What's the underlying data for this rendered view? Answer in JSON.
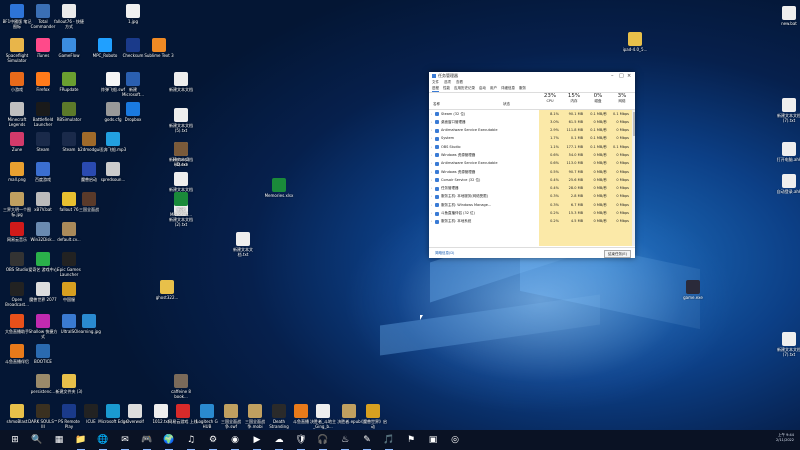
{
  "desktop": {
    "icons": [
      {
        "label": "BF1中國版 笔记图标",
        "color": "#2d74d9"
      },
      {
        "label": "Total Commander",
        "color": "#3a6fb5"
      },
      {
        "label": "fallout76 - 快捷方式",
        "color": "#eaeaea"
      },
      {
        "label": "1.jpg",
        "color": "#f0f0f0"
      },
      {
        "label": "Spaceflight Simulator",
        "color": "#e8b54a"
      },
      {
        "label": "iTunes",
        "color": "#ff4a8a"
      },
      {
        "label": "GameFlow",
        "color": "#3b8de0"
      },
      {
        "label": "MPC_Roboto",
        "color": "#20a0ff"
      },
      {
        "label": "Checksum",
        "color": "#1a3a8a"
      },
      {
        "label": "Sublime Text 3",
        "color": "#f08a24"
      },
      {
        "label": "新建文本文档",
        "color": "#eeeeee"
      },
      {
        "label": "小游戏",
        "color": "#e86a1a"
      },
      {
        "label": "Firefox",
        "color": "#ff7a1a"
      },
      {
        "label": "FRupdate",
        "color": "#6aa030"
      },
      {
        "label": "炸弹飞船.swf",
        "color": "#f5f5f5"
      },
      {
        "label": "新建 Microsoft...",
        "color": "#2a5fb0"
      },
      {
        "label": "新建文本文档 (5).txt",
        "color": "#eeeeee"
      },
      {
        "label": "Minecraft Legends",
        "color": "#c0c0c0"
      },
      {
        "label": "Battlefield Launcher",
        "color": "#1a1a1a"
      },
      {
        "label": "RBSimulator",
        "color": "#5c7a2a"
      },
      {
        "label": "gods.cfg",
        "color": "#999999"
      },
      {
        "label": "Dropbox",
        "color": "#1a7ae0"
      },
      {
        "label": "新建文本文档 (4).txt",
        "color": "#eeeeee"
      },
      {
        "label": "Zune",
        "color": "#d23a6a"
      },
      {
        "label": "Steam",
        "color": "#1a2a4a"
      },
      {
        "label": "Steam",
        "color": "#1a2a4a"
      },
      {
        "label": "b2dmodgui",
        "color": "#a06a2a"
      },
      {
        "label": "丢弃飞船.mp3",
        "color": "#22a0e0"
      },
      {
        "label": "新建文本文档 (3).txt",
        "color": "#eeeeee"
      },
      {
        "label": "新建文本文档 (2).txt",
        "color": "#eeeeee"
      },
      {
        "label": "mall.png",
        "color": "#e8a030"
      },
      {
        "label": "百度游戏",
        "color": "#3b6fd0"
      },
      {
        "label": "魔兽启动",
        "color": "#2a4ab0"
      },
      {
        "label": "spredsoun...",
        "color": "#cccccc"
      },
      {
        "label": "Heroes3 HD.exe",
        "color": "#7a5a3a"
      },
      {
        "label": "三界大明一个图标.jpg",
        "color": "#c0a060"
      },
      {
        "label": "xB7V.bat",
        "color": "#bbbbbb"
      },
      {
        "label": "fallout 76",
        "color": "#e8c030"
      },
      {
        "label": "三国全面战",
        "color": "#5a3a2a"
      },
      {
        "label": "新建 Microsoft...",
        "color": "#1a8a3a"
      },
      {
        "label": "网易云音乐",
        "color": "#d01a1a"
      },
      {
        "label": "Win32Disk...",
        "color": "#6a8ab0"
      },
      {
        "label": "default.cv...",
        "color": "#aa8a5a"
      },
      {
        "label": "OBS Studio",
        "color": "#333333"
      },
      {
        "label": "爱奇艺 游戏中心",
        "color": "#2ab04a"
      },
      {
        "label": "Epic Games Launcher",
        "color": "#222222"
      },
      {
        "label": "Open Broadcast...",
        "color": "#222222"
      },
      {
        "label": "魔兽世界 2077",
        "color": "#dddddd"
      },
      {
        "label": "中国服",
        "color": "#d8a020"
      },
      {
        "label": "ghost322...",
        "color": "#e8c04a"
      },
      {
        "label": "大鱼直播助手",
        "color": "#e8501a"
      },
      {
        "label": "Shallow 快捷方式",
        "color": "#c02ab0"
      },
      {
        "label": "UltraISO",
        "color": "#3a7ad0"
      },
      {
        "label": "learning.jpg",
        "color": "#2a8ad0"
      },
      {
        "label": "斗鱼直播伴侣",
        "color": "#e87a1a"
      },
      {
        "label": "BOOTICE",
        "color": "#2a6ab0"
      },
      {
        "label": "persistenc...",
        "color": "#9a8a6a"
      },
      {
        "label": "新建文件夹 (3)",
        "color": "#e8c04a"
      },
      {
        "label": "caffeine 8 book...",
        "color": "#7a6a5a"
      },
      {
        "label": "shmoBlast",
        "color": "#e8c04a"
      },
      {
        "label": "DARK SOULS™ III",
        "color": "#3a3020"
      },
      {
        "label": "PS Remote Play",
        "color": "#1a3a8a"
      },
      {
        "label": "ICUE",
        "color": "#222222"
      },
      {
        "label": "Microsoft Edge",
        "color": "#1a9ad0"
      },
      {
        "label": "Overwolf",
        "color": "#dddddd"
      },
      {
        "label": "1012.txt",
        "color": "#eeeeee"
      },
      {
        "label": "网易云游戏 上线",
        "color": "#d82a2a"
      },
      {
        "label": "Logitech G HUB",
        "color": "#2a8ad0"
      },
      {
        "label": "三国全面战争.swf",
        "color": "#c0a060"
      },
      {
        "label": "三国全面战争.mobi",
        "color": "#c0a060"
      },
      {
        "label": "Death Stranding",
        "color": "#2a2a2a"
      },
      {
        "label": "斗鱼直播",
        "color": "#e87a1a"
      },
      {
        "label": "决胜者_斗地主_Ging_b...",
        "color": "#eeeeee"
      },
      {
        "label": "决胜者.epub",
        "color": "#c0a060"
      },
      {
        "label": "《魔兽世界》启动",
        "color": "#d8a020"
      },
      {
        "label": "ipad-4.0_5...",
        "color": "#e8c04a"
      },
      {
        "label": "new.bat",
        "color": "#eeeeee"
      },
      {
        "label": "新建文本文档 (7).txt",
        "color": "#eeeeee"
      },
      {
        "label": "打开电脑.ahk",
        "color": "#eeeeee"
      },
      {
        "label": "自动登录.ahk",
        "color": "#eeeeee"
      },
      {
        "label": "Memories.xlsx",
        "color": "#1a8a3a"
      },
      {
        "label": "新建文本文档.txt",
        "color": "#eeeeee"
      },
      {
        "label": "新建文本文档 (7).txt",
        "color": "#eeeeee"
      },
      {
        "label": "game.exe",
        "color": "#2a2a3a"
      }
    ]
  },
  "taskmanager": {
    "title": "任务管理器",
    "menu": [
      "文件",
      "选项",
      "查看"
    ],
    "tabs": [
      "进程",
      "性能",
      "应用历史记录",
      "启动",
      "用户",
      "详细信息",
      "服务"
    ],
    "header_name": "名称",
    "header_status": "状态",
    "columns": [
      {
        "pct": "23%",
        "label": "CPU"
      },
      {
        "pct": "15%",
        "label": "内存"
      },
      {
        "pct": "0%",
        "label": "磁盘"
      },
      {
        "pct": "3%",
        "label": "网络"
      }
    ],
    "rows": [
      {
        "name": "Steam (32 位)",
        "cpu": "8.1%",
        "mem": "90.1 MB",
        "disk": "0.1 MB/秒",
        "net": "0.1 Mbps"
      },
      {
        "name": "桌面窗口管理器",
        "cpu": "3.0%",
        "mem": "61.5 MB",
        "disk": "0 MB/秒",
        "net": "0 Mbps"
      },
      {
        "name": "Antimalware Service Executable",
        "cpu": "2.9%",
        "mem": "111.8 MB",
        "disk": "0.1 MB/秒",
        "net": "0 Mbps"
      },
      {
        "name": "System",
        "cpu": "1.7%",
        "mem": "0.1 MB",
        "disk": "0.1 MB/秒",
        "net": "0 Mbps"
      },
      {
        "name": "OBS Studio",
        "cpu": "1.1%",
        "mem": "177.1 MB",
        "disk": "0.1 MB/秒",
        "net": "0.1 Mbps"
      },
      {
        "name": "Windows 资源管理器",
        "cpu": "0.6%",
        "mem": "54.0 MB",
        "disk": "0 MB/秒",
        "net": "0 Mbps"
      },
      {
        "name": "Antimalware Service Executable",
        "cpu": "0.6%",
        "mem": "113.0 MB",
        "disk": "0 MB/秒",
        "net": "0 Mbps"
      },
      {
        "name": "Windows 资源管理器",
        "cpu": "0.5%",
        "mem": "90.7 MB",
        "disk": "0 MB/秒",
        "net": "0 Mbps"
      },
      {
        "name": "Corsair Service (32 位)",
        "cpu": "0.4%",
        "mem": "25.6 MB",
        "disk": "0 MB/秒",
        "net": "0 Mbps"
      },
      {
        "name": "任务管理器",
        "cpu": "0.4%",
        "mem": "28.0 MB",
        "disk": "0 MB/秒",
        "net": "0 Mbps"
      },
      {
        "name": "服务主机: 本地服务(网络受限)",
        "cpu": "0.3%",
        "mem": "2.8 MB",
        "disk": "0 MB/秒",
        "net": "0 Mbps"
      },
      {
        "name": "服务主机: Windows Manage...",
        "cpu": "0.3%",
        "mem": "6.7 MB",
        "disk": "0 MB/秒",
        "net": "0 Mbps"
      },
      {
        "name": "斗鱼直播伴侣 (32 位)",
        "cpu": "0.2%",
        "mem": "15.3 MB",
        "disk": "0 MB/秒",
        "net": "0 Mbps"
      },
      {
        "name": "服务主机: 本地系统",
        "cpu": "0.2%",
        "mem": "4.5 MB",
        "disk": "0 MB/秒",
        "net": "0 Mbps"
      }
    ],
    "fewer_details": "简略信息(D)",
    "end_task": "结束任务(E)"
  },
  "taskbar": {
    "items": [
      "⊞",
      "🔍",
      "▦",
      "📁",
      "🌐",
      "✉",
      "🎮",
      "🌍",
      "♫",
      "⚙",
      "◉",
      "▶",
      "☁",
      "🛡",
      "🎧",
      "♨",
      "✎",
      "🎵",
      "⚑",
      "▣",
      "◎"
    ],
    "time": "上午 9:44",
    "date": "2/11/2022"
  }
}
